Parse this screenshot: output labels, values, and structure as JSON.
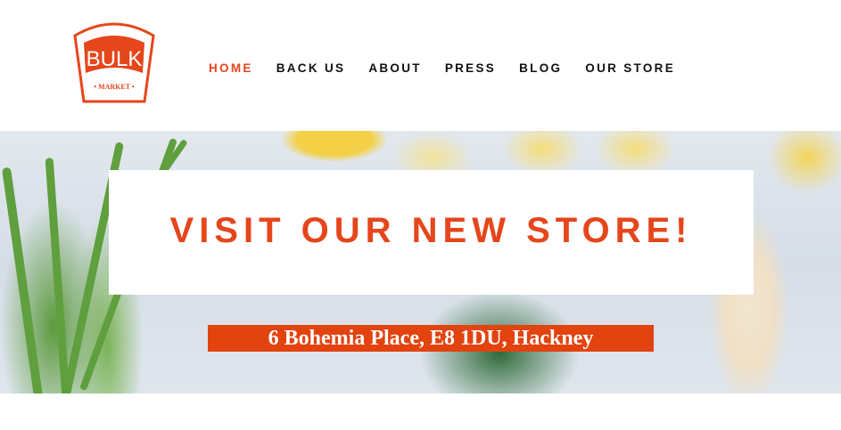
{
  "logo": {
    "brand": "BULK",
    "sub": "MARKET"
  },
  "nav": {
    "items": [
      {
        "label": "HOME",
        "active": true
      },
      {
        "label": "BACK US"
      },
      {
        "label": "ABOUT"
      },
      {
        "label": "PRESS"
      },
      {
        "label": "BLOG"
      },
      {
        "label": "OUR STORE"
      }
    ]
  },
  "hero": {
    "title": "VISIT OUR NEW STORE!",
    "address": "6 Bohemia Place, E8 1DU, Hackney"
  },
  "colors": {
    "accent": "#e5461b"
  }
}
